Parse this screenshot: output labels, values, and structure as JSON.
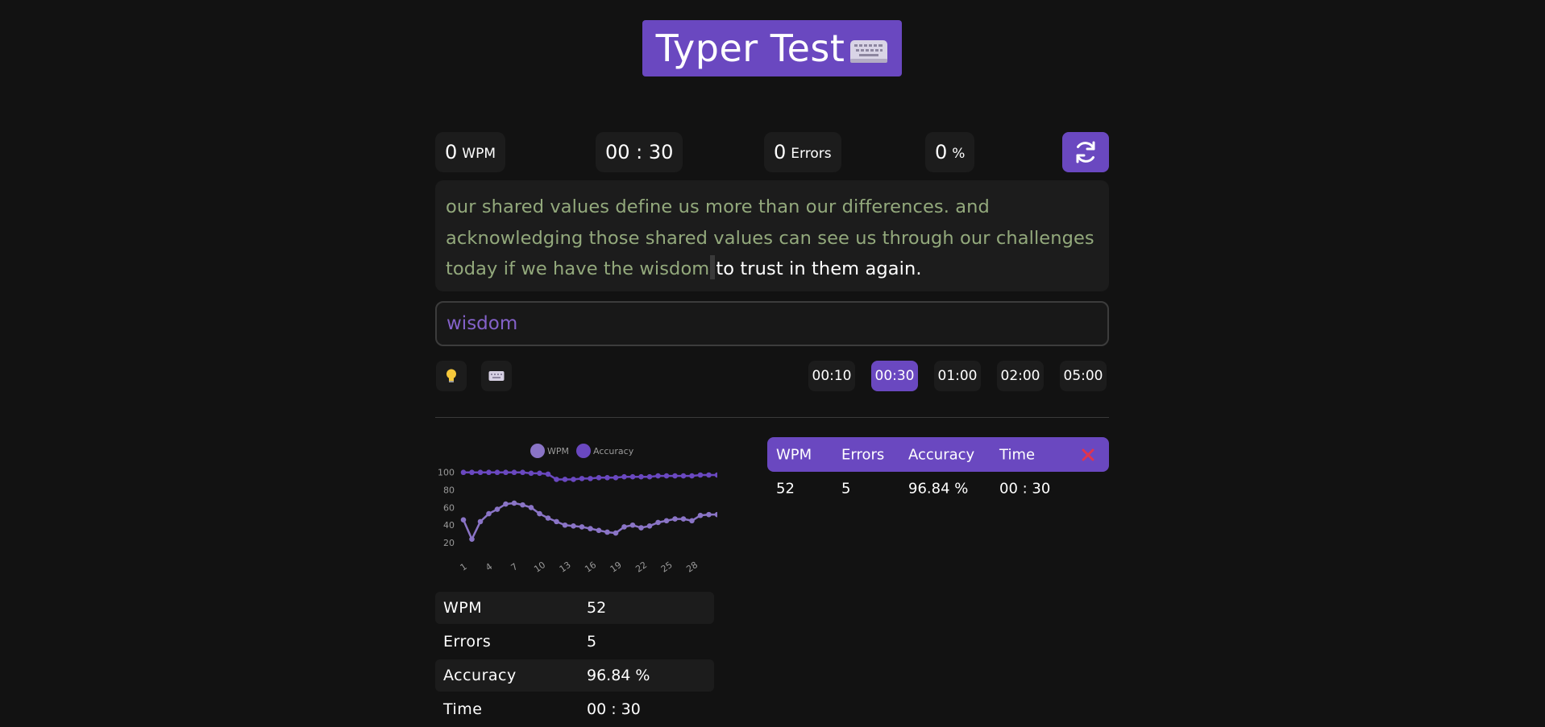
{
  "header": {
    "title": "Typer Test"
  },
  "stats": {
    "wpm_value": "0",
    "wpm_unit": "WPM",
    "timer": "00 : 30",
    "errors_value": "0",
    "errors_unit": "Errors",
    "accuracy_value": "0",
    "accuracy_unit": "%"
  },
  "passage": {
    "typed": "our shared values define us more than our differences. and acknowledging those shared values can see us through our challenges today if we have the wisdom",
    "remaining": "to trust in them again."
  },
  "input": {
    "value": "wisdom"
  },
  "time_options": [
    {
      "label": "00:10",
      "active": false
    },
    {
      "label": "00:30",
      "active": true
    },
    {
      "label": "01:00",
      "active": false
    },
    {
      "label": "02:00",
      "active": false
    },
    {
      "label": "05:00",
      "active": false
    }
  ],
  "icons": [
    "lightbulb-icon",
    "keyboard-icon",
    "refresh-icon",
    "close-icon"
  ],
  "colors": {
    "accent": "#6a48c0",
    "typed_text": "#93a97c",
    "input_text": "#8461c9",
    "close": "#e0344f"
  },
  "chart_data": {
    "type": "line",
    "x": [
      1,
      2,
      3,
      4,
      5,
      6,
      7,
      8,
      9,
      10,
      11,
      12,
      13,
      14,
      15,
      16,
      17,
      18,
      19,
      20,
      21,
      22,
      23,
      24,
      25,
      26,
      27,
      28,
      29,
      30
    ],
    "xticks": [
      "1",
      "4",
      "7",
      "10",
      "13",
      "16",
      "19",
      "22",
      "25",
      "28"
    ],
    "yticks": [
      "100",
      "80",
      "60",
      "40",
      "20"
    ],
    "ylim": [
      10,
      108
    ],
    "series": [
      {
        "name": "WPM",
        "color": "#8a74c6",
        "values": [
          46,
          24,
          44,
          53,
          58,
          64,
          65,
          63,
          60,
          53,
          48,
          44,
          40,
          39,
          38,
          36,
          34,
          32,
          31,
          38,
          40,
          37,
          39,
          43,
          45,
          47,
          47,
          45,
          51,
          52,
          52
        ]
      },
      {
        "name": "Accuracy",
        "color": "#6a48c0",
        "values": [
          100,
          100,
          100,
          100,
          100,
          100,
          100,
          100,
          99,
          99,
          98,
          92,
          92,
          92,
          93,
          93,
          94,
          94,
          94,
          95,
          95,
          95,
          95,
          96,
          96,
          96,
          96,
          96,
          97,
          97,
          97
        ]
      }
    ]
  },
  "summary": [
    {
      "label": "WPM",
      "value": "52"
    },
    {
      "label": "Errors",
      "value": "5"
    },
    {
      "label": "Accuracy",
      "value": "96.84 %"
    },
    {
      "label": "Time",
      "value": "00 : 30"
    }
  ],
  "history": {
    "headers": [
      "WPM",
      "Errors",
      "Accuracy",
      "Time"
    ],
    "rows": [
      [
        "52",
        "5",
        "96.84 %",
        "00 : 30"
      ]
    ]
  }
}
